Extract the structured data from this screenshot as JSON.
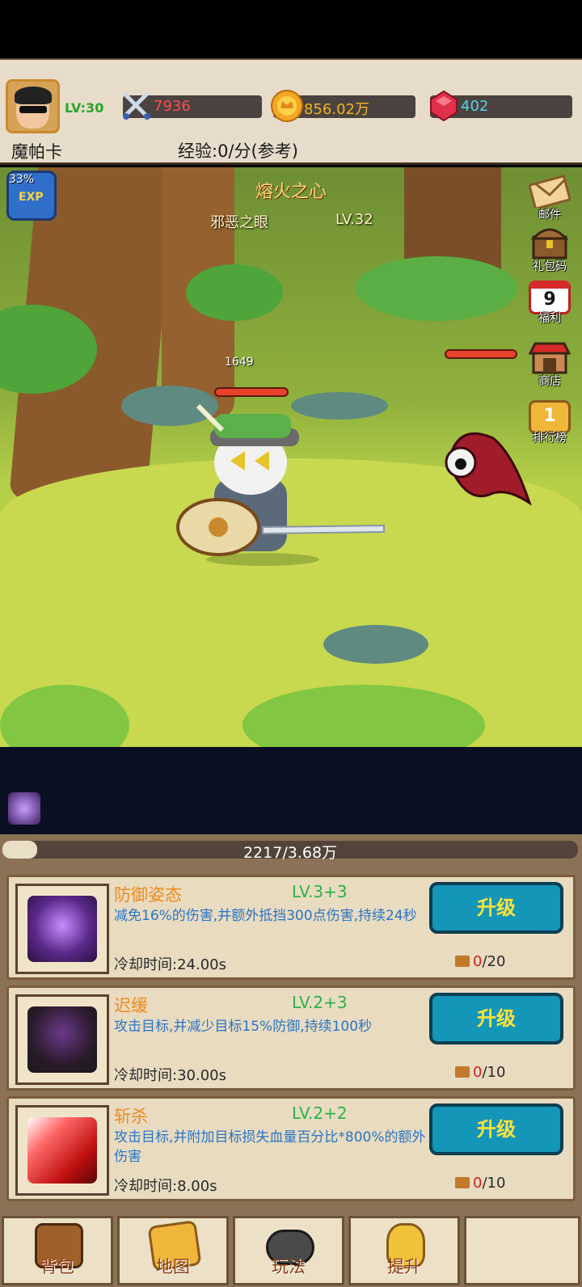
{
  "header": {
    "player_name": "魔帕卡",
    "level": "LV:30",
    "power": "7936",
    "gold": "856.02万",
    "gems": "402",
    "exp_text": "经验:0/分(参考)"
  },
  "scene": {
    "stage_title": "熔火之心",
    "enemy_name": "邪恶之眼",
    "enemy_level": "LV.32",
    "hero_hp": "1649",
    "exp_boost_pct": "33%",
    "exp_boost_label": "EXP"
  },
  "side_menu": {
    "mail": "邮件",
    "gift_code": "礼包码",
    "welfare": "福利",
    "welfare_day": "9",
    "shop": "商店",
    "ranking": "排行榜",
    "ranking_num": "1"
  },
  "skills": {
    "progress_text": "2217/3.68万",
    "progress": 0.06,
    "items": [
      {
        "name": "防御姿态",
        "level": "LV.3+3",
        "desc": "减免16%的伤害,并额外抵挡300点伤害,持续24秒",
        "cooldown": "冷却时间:24.00s",
        "button": "升级",
        "cost_have": "0",
        "cost_need": "/20"
      },
      {
        "name": "迟缓",
        "level": "LV.2+3",
        "desc": "攻击目标,并减少目标15%防御,持续100秒",
        "cooldown": "冷却时间:30.00s",
        "button": "升级",
        "cost_have": "0",
        "cost_need": "/10"
      },
      {
        "name": "斩杀",
        "level": "LV.2+2",
        "desc": "攻击目标,并附加目标损失血量百分比*800%的额外伤害",
        "cooldown": "冷却时间:8.00s",
        "button": "升级",
        "cost_have": "0",
        "cost_need": "/10"
      }
    ]
  },
  "nav": {
    "bag": "背包",
    "map": "地图",
    "gameplay": "玩法",
    "upgrade": "提升"
  }
}
